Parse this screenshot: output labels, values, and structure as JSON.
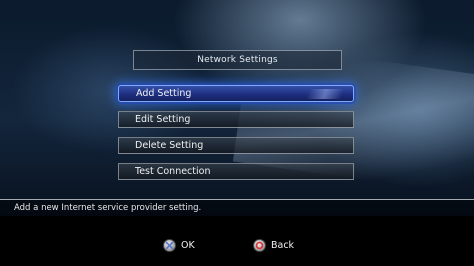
{
  "header": {
    "title": "Network Settings"
  },
  "menu": {
    "items": [
      {
        "label": "Add Setting",
        "selected": true
      },
      {
        "label": "Edit Setting",
        "selected": false
      },
      {
        "label": "Delete Setting",
        "selected": false
      },
      {
        "label": "Test Connection",
        "selected": false
      }
    ]
  },
  "help": {
    "text": "Add a new Internet service provider setting."
  },
  "controls": {
    "ok": {
      "label": "OK",
      "icon": "cross-button-icon"
    },
    "back": {
      "label": "Back",
      "icon": "circle-button-icon"
    }
  },
  "colors": {
    "selection": "#1e2f82",
    "selection_glow": "#326ee6",
    "cross_mark": "#6a86d8",
    "circle_mark": "#e23030"
  }
}
